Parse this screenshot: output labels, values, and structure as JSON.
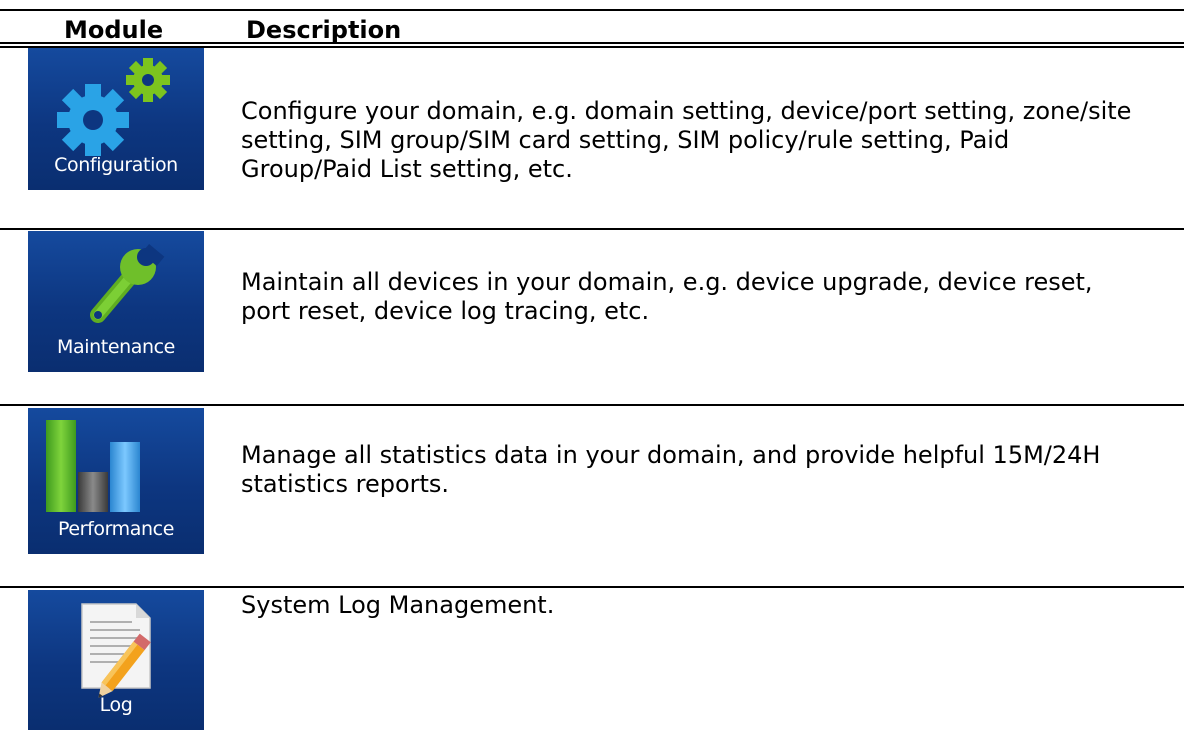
{
  "table": {
    "headers": {
      "module": "Module",
      "description": "Description"
    },
    "rows": [
      {
        "module_label": "Configuration",
        "icon": "gears-icon",
        "description": "Configure your domain, e.g. domain setting, device/port setting, zone/site setting, SIM group/SIM card setting, SIM policy/rule setting, Paid Group/Paid List setting, etc."
      },
      {
        "module_label": "Maintenance",
        "icon": "wrench-icon",
        "description": "Maintain all devices in your domain, e.g. device upgrade, device reset, port reset, device log tracing, etc."
      },
      {
        "module_label": "Performance",
        "icon": "bar-chart-icon",
        "description": "Manage all statistics data in your domain, and provide helpful 15M/24H statistics reports."
      },
      {
        "module_label": "Log",
        "icon": "document-pencil-icon",
        "description": "System Log Management."
      }
    ]
  },
  "colors": {
    "tile_background": "#0d3680",
    "gear_blue": "#2aa3e6",
    "gear_green": "#7cc41e",
    "wrench_green": "#6fbf2a",
    "bar_green": "#4caf2a",
    "bar_gray": "#555555",
    "bar_blue": "#3aa0e8"
  }
}
